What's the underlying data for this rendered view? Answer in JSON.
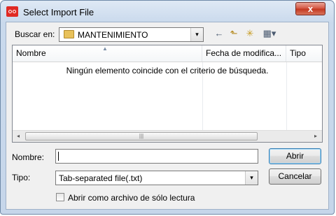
{
  "window": {
    "title": "Select Import File",
    "close_label": "x"
  },
  "look_in": {
    "label": "Buscar en:",
    "value": "MANTENIMIENTO",
    "arrow": "▾"
  },
  "toolbar": {
    "back_glyph": "←",
    "up_glyph": "⬑",
    "newfolder_glyph": "✳",
    "view_glyph": "▦▾"
  },
  "list": {
    "columns": [
      "Nombre",
      "Fecha de modifica...",
      "Tipo"
    ],
    "empty_message": "Ningún elemento coincide con el criterio de búsqueda.",
    "scroll_left": "◂",
    "scroll_right": "▸",
    "thumb_grip": "|||"
  },
  "form": {
    "name_label": "Nombre:",
    "name_value": "",
    "type_label": "Tipo:",
    "type_value": "Tab-separated file(.txt)",
    "open_button": "Abrir",
    "cancel_button": "Cancelar",
    "readonly_label": "Abrir como archivo de sólo lectura"
  }
}
